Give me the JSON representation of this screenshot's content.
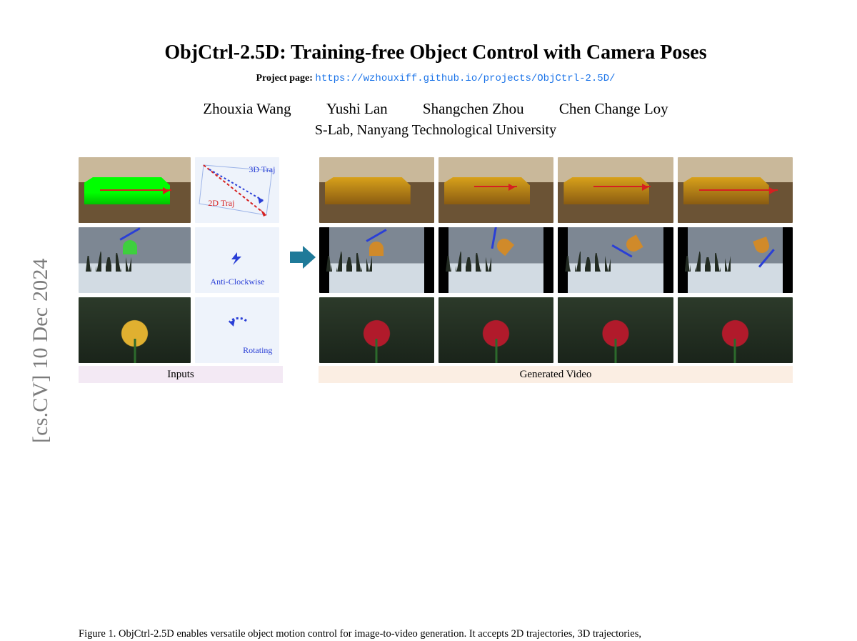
{
  "arxiv_tag": "[cs.CV]  10 Dec 2024",
  "title": "ObjCtrl-2.5D: Training-free Object Control with Camera Poses",
  "project_label": "Project page: ",
  "project_url": "https://wzhouxiff.github.io/projects/ObjCtrl-2.5D/",
  "authors": [
    "Zhouxia Wang",
    "Yushi Lan",
    "Shangchen Zhou",
    "Chen Change Loy"
  ],
  "affiliation": "S-Lab, Nanyang Technological University",
  "controls": {
    "row1": {
      "label_a": "3D Traj",
      "label_b": "2D Traj"
    },
    "row2": {
      "label": "Anti-Clockwise"
    },
    "row3": {
      "label": "Rotating"
    }
  },
  "figure_labels": {
    "inputs": "Inputs",
    "generated": "Generated Video"
  },
  "caption": "Figure 1. ObjCtrl-2.5D enables versatile object motion control for image-to-video generation. It accepts 2D trajectories, 3D trajectories,"
}
